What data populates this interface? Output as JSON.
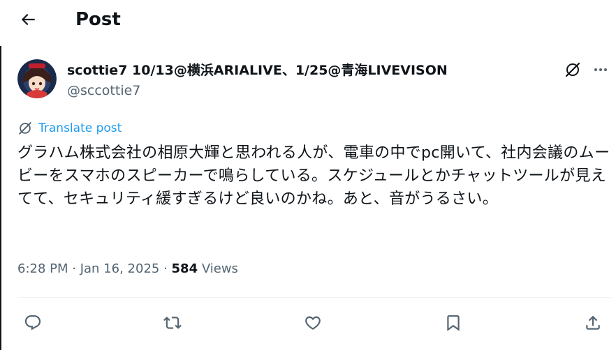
{
  "header": {
    "title": "Post",
    "back_icon": "arrow-left-icon"
  },
  "author": {
    "display_name": "scottie7 10/13@横浜ARIALIVE、1/25@青海LIVEVISON",
    "handle": "@sccottie7",
    "avatar_icon": "avatar-icon"
  },
  "translate": {
    "label": "Translate post",
    "icon": "grok-icon"
  },
  "post": {
    "text": "グラハム株式会社の相原大輝と思われる人が、電車の中でpc開いて、社内会議のムービーをスマホのスピーカーで鳴らしている。スケジュールとかチャットツールが見えてて、セキュリティ緩すぎるけど良いのかね。あと、音がうるさい。"
  },
  "meta": {
    "time": "6:28 PM",
    "date": "Jan 16, 2025",
    "views_count": "584",
    "views_label": "Views"
  },
  "actions": [
    "reply-icon",
    "repost-icon",
    "like-icon",
    "bookmark-icon",
    "share-icon"
  ],
  "colors": {
    "accent": "#1d9bf0",
    "text": "#0f1419",
    "secondary": "#536471"
  }
}
